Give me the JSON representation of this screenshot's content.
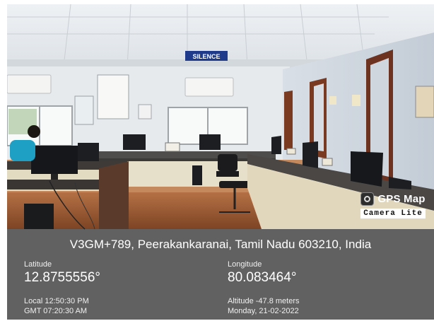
{
  "sign": {
    "text": "SILENCE"
  },
  "watermark": {
    "app_name": "GPS Map",
    "app_subtitle": "Camera Lite",
    "icon": "camera-icon"
  },
  "geo": {
    "address": "V3GM+789, Peerakankaranai, Tamil Nadu 603210, India",
    "latitude_label": "Latitude",
    "latitude_value": "12.8755556°",
    "longitude_label": "Longitude",
    "longitude_value": "80.083464°",
    "local_time": "Local 12:50:30 PM",
    "gmt_time": "GMT 07:20:30 AM",
    "altitude": "Altitude -47.8 meters",
    "date": "Monday, 21-02-2022"
  }
}
